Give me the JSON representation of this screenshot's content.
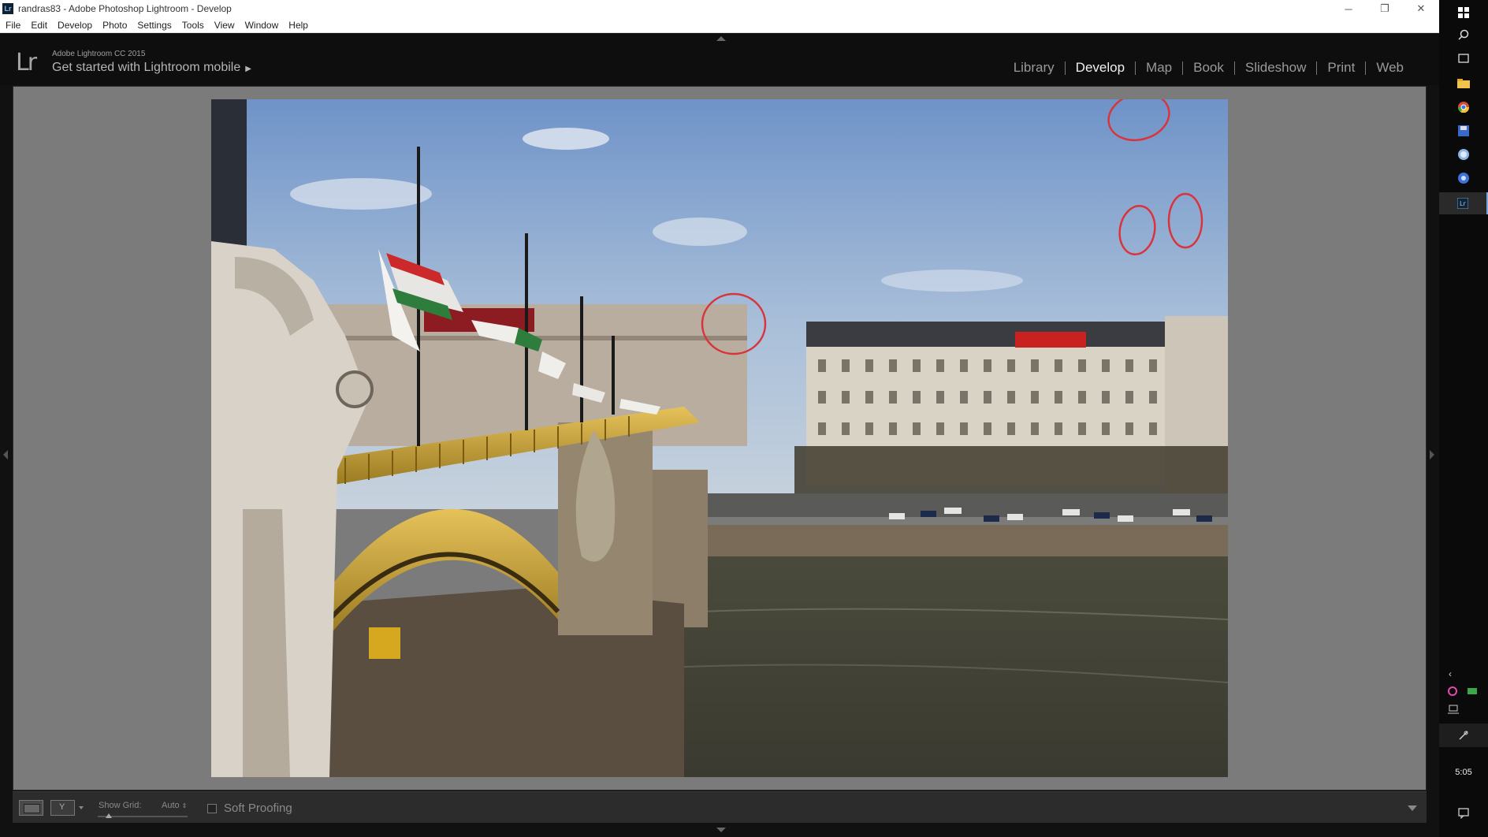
{
  "window": {
    "title": "randras83 - Adobe Photoshop Lightroom - Develop",
    "app_icon": "Lr",
    "controls": [
      "─",
      "❐",
      "✕"
    ]
  },
  "menu": [
    "File",
    "Edit",
    "Develop",
    "Photo",
    "Settings",
    "Tools",
    "View",
    "Window",
    "Help"
  ],
  "identity": {
    "logo": "Lr",
    "product": "Adobe Lightroom CC 2015",
    "mobile_link": "Get started with Lightroom mobile",
    "mobile_arrow": "▶"
  },
  "modules": [
    {
      "label": "Library",
      "active": false
    },
    {
      "label": "Develop",
      "active": true
    },
    {
      "label": "Map",
      "active": false
    },
    {
      "label": "Book",
      "active": false
    },
    {
      "label": "Slideshow",
      "active": false
    },
    {
      "label": "Print",
      "active": false
    },
    {
      "label": "Web",
      "active": false
    }
  ],
  "toolbar": {
    "show_grid_label": "Show Grid:",
    "grid_value": "Auto",
    "grid_updown": "⇕",
    "soft_proofing_label": "Soft Proofing",
    "soft_proofing_checked": false
  },
  "taskbar": {
    "clock": "5:05",
    "items": [
      "windows-start-icon",
      "search-icon",
      "task-view-icon",
      "file-explorer-icon",
      "chrome-icon",
      "save-disk-icon",
      "globe-icon",
      "chrome-alt-icon",
      "lightroom-app-icon"
    ],
    "tray": [
      "chevron-left-icon",
      "color-wheel-icon",
      "card-icon",
      "network-icon",
      "pen-icon",
      "notification-icon"
    ]
  },
  "colors": {
    "active_module": "#f0f0f0",
    "inactive_module": "#9a9a9a",
    "annotation_circle": "#d9343c"
  }
}
